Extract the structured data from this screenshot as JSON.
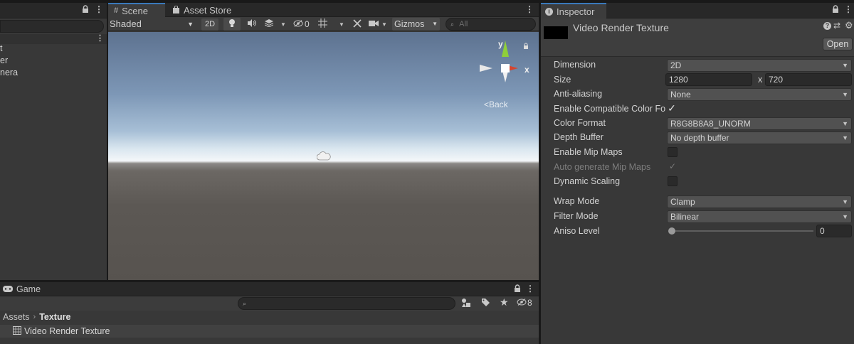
{
  "hierarchy": {
    "items": [
      "t",
      "er",
      "nera"
    ]
  },
  "scene": {
    "tabs": [
      {
        "label": "Scene",
        "icon": "grid-icon"
      },
      {
        "label": "Asset Store",
        "icon": "shopping-bag-icon"
      }
    ],
    "toolbar": {
      "shading_mode": "Shaded",
      "mode_2d": "2D",
      "hidden_count": "0",
      "gizmos_label": "Gizmos",
      "search_placeholder": "All"
    },
    "orientation": {
      "y_label": "y",
      "x_label": "x",
      "view_label": "<Back"
    }
  },
  "game": {
    "tab_label": "Game",
    "hidden_count": "8",
    "breadcrumb": [
      "Assets",
      "Texture"
    ],
    "asset_item": "Video Render Texture"
  },
  "inspector": {
    "tab_label": "Inspector",
    "asset_name": "Video Render Texture",
    "open_button": "Open",
    "properties": {
      "dimension": {
        "label": "Dimension",
        "value": "2D"
      },
      "size": {
        "label": "Size",
        "width": "1280",
        "x_label": "x",
        "height": "720"
      },
      "anti_aliasing": {
        "label": "Anti-aliasing",
        "value": "None"
      },
      "compat_color": {
        "label": "Enable Compatible Color Fo",
        "checked": true
      },
      "color_format": {
        "label": "Color Format",
        "value": "R8G8B8A8_UNORM"
      },
      "depth_buffer": {
        "label": "Depth Buffer",
        "value": "No depth buffer"
      },
      "mip_maps": {
        "label": "Enable Mip Maps",
        "checked": false
      },
      "auto_mip": {
        "label": "Auto generate Mip Maps",
        "checked": true
      },
      "dynamic_scaling": {
        "label": "Dynamic Scaling",
        "checked": false
      },
      "wrap_mode": {
        "label": "Wrap Mode",
        "value": "Clamp"
      },
      "filter_mode": {
        "label": "Filter Mode",
        "value": "Bilinear"
      },
      "aniso_level": {
        "label": "Aniso Level",
        "value": "0"
      }
    }
  },
  "colors": {
    "accent": "#3a79bb",
    "panel": "#383838",
    "axis_x": "#d6452f",
    "axis_y": "#8fcf3a"
  }
}
